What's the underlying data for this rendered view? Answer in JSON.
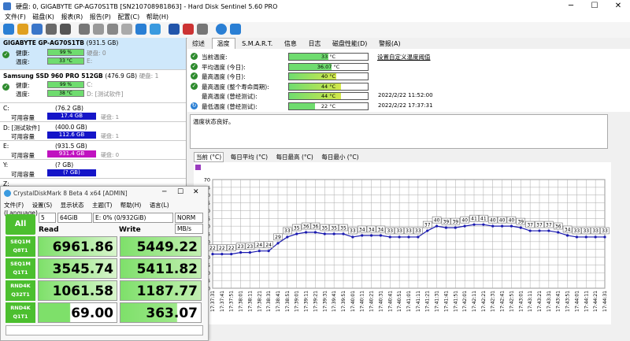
{
  "window": {
    "title": "硬盘: 0, GIGABYTE GP-AG70S1TB [SN210708981863] - Hard Disk Sentinel 5.60 PRO"
  },
  "menu": [
    "文件(F)",
    "磁盘(K)",
    "报表(R)",
    "报告(P)",
    "配置(C)",
    "帮助(H)"
  ],
  "disks": [
    {
      "name": "GIGABYTE GP-AG70S1TB",
      "size": "(931.5 GB)",
      "health_label": "健康:",
      "health": "99 %",
      "health_pct": 99,
      "health_extra": "硬盘: 0",
      "temp_label": "温度:",
      "temp": "33 °C",
      "temp_extra": "E:"
    },
    {
      "name": "Samsung SSD 960 PRO 512GB",
      "size": "(476.9 GB)",
      "extra": "硬盘: 1",
      "health_label": "健康:",
      "health": "99 %",
      "health_pct": 99,
      "health_extra": "C:",
      "temp_label": "温度:",
      "temp": "38 °C",
      "temp_extra": "D: [测试软件]"
    }
  ],
  "volumes": [
    {
      "letter": "C:",
      "size": "(76.2 GB)",
      "label": "可用容量",
      "free": "17.4 GB",
      "free_pct": 23,
      "color": "#1515c8",
      "hdd": "硬盘: 1"
    },
    {
      "letter": "D: [测试软件]",
      "size": "(400.0 GB)",
      "label": "可用容量",
      "free": "112.6 GB",
      "free_pct": 28,
      "color": "#1515c8",
      "hdd": "硬盘: 1"
    },
    {
      "letter": "E:",
      "size": "(931.5 GB)",
      "label": "可用容量",
      "free": "931.4 GB",
      "free_pct": 100,
      "color": "#c012c0",
      "hdd": "硬盘: 0"
    },
    {
      "letter": "Y:",
      "size": "(? GB)",
      "label": "可用容量",
      "free": "(? GB)",
      "free_pct": 0,
      "color": "#1515c8",
      "hdd": ""
    },
    {
      "letter": "Z:",
      "size": "",
      "label": "",
      "free": "",
      "free_pct": 0,
      "color": "#1515c8",
      "hdd": ""
    }
  ],
  "tabs": [
    "综述",
    "温度",
    "S.M.A.R.T.",
    "信息",
    "日志",
    "磁盘性能(D)",
    "警报(A)"
  ],
  "temperature": {
    "link": "设置自定义温度阈值",
    "rows": [
      {
        "label": "当前温度:",
        "value": "33 °C",
        "pct": 33,
        "date": ""
      },
      {
        "label": "平均温度 (今日):",
        "value": "36.07 °C",
        "pct": 36,
        "date": ""
      },
      {
        "label": "最高温度 (今日):",
        "value": "40 °C",
        "pct": 40,
        "date": ""
      },
      {
        "label": "最高温度 (整个寿命周期):",
        "value": "44 °C",
        "pct": 44,
        "date": ""
      },
      {
        "label": "最高温度 (曾经测试):",
        "value": "44 °C",
        "pct": 44,
        "date": "2022/2/22 11:52:00"
      },
      {
        "label": "最低温度 (曾经测试):",
        "value": "22 °C",
        "pct": 22,
        "date": "2022/2/22 17:37:31"
      }
    ],
    "status": "温度状态良好。"
  },
  "chart_tabs": [
    "当前 (°C)",
    "每日平均 (°C)",
    "每日最高 (°C)",
    "每日最小 (°C)"
  ],
  "chart_data": {
    "type": "line",
    "x": [
      "17:37:31",
      "17:37:41",
      "17:37:51",
      "17:38:01",
      "17:38:11",
      "17:38:21",
      "17:38:31",
      "17:38:41",
      "17:38:51",
      "17:39:01",
      "17:39:11",
      "17:39:21",
      "17:39:31",
      "17:39:41",
      "17:39:51",
      "17:40:01",
      "17:40:11",
      "17:40:21",
      "17:40:31",
      "17:40:41",
      "17:40:51",
      "17:41:01",
      "17:41:11",
      "17:41:21",
      "17:41:31",
      "17:41:41",
      "17:41:51",
      "17:42:01",
      "17:42:11",
      "17:42:21",
      "17:42:31",
      "17:42:41",
      "17:42:51",
      "17:43:01",
      "17:43:11",
      "17:43:21",
      "17:43:31",
      "17:43:41",
      "17:43:51",
      "17:44:01",
      "17:44:11",
      "17:44:21",
      "17:44:31"
    ],
    "values": [
      22,
      22,
      22,
      23,
      23,
      24,
      24,
      29,
      33,
      35,
      36,
      36,
      35,
      35,
      35,
      33,
      34,
      34,
      34,
      33,
      33,
      33,
      33,
      37,
      40,
      39,
      39,
      40,
      41,
      41,
      40,
      40,
      40,
      39,
      37,
      37,
      37,
      36,
      34,
      33,
      33,
      33,
      33
    ],
    "ylim": [
      0,
      70
    ],
    "yticks": [
      0,
      5,
      10,
      15,
      20,
      25,
      30,
      35,
      40,
      45,
      50,
      55,
      60,
      65,
      70
    ],
    "grid": true
  },
  "cdm": {
    "title": "CrystalDiskMark 8 Beta 4 x64 [ADMIN]",
    "menu": [
      "文件(F)",
      "设置(S)",
      "显示状态",
      "主题(T)",
      "帮助(H)",
      "语言(L)(Language)"
    ],
    "all": "All",
    "count": "5",
    "size": "64GiB",
    "drive": "E: 0% (0/932GiB)",
    "mode": "NORM",
    "unit": "MB/s",
    "read_hdr": "Read",
    "write_hdr": "Write",
    "tests": [
      {
        "l1": "SEQ1M",
        "l2": "Q8T1",
        "read": "6961.86",
        "write": "5449.22"
      },
      {
        "l1": "SEQ1M",
        "l2": "Q1T1",
        "read": "3545.74",
        "write": "5411.82"
      },
      {
        "l1": "RND4K",
        "l2": "Q32T1",
        "read": "1061.58",
        "write": "1187.77"
      },
      {
        "l1": "RND4K",
        "l2": "Q1T1",
        "read": "69.00",
        "write": "363.07"
      }
    ]
  }
}
